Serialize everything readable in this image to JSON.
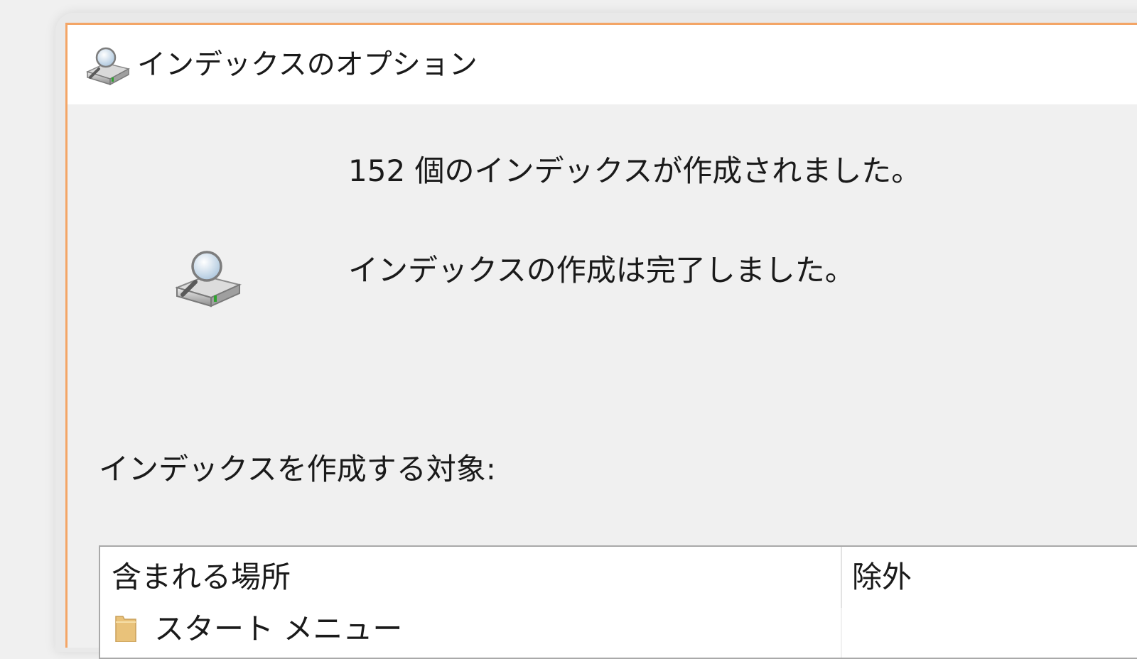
{
  "window": {
    "title": "インデックスのオプション",
    "accent_color": "#f3a566"
  },
  "status": {
    "count_message": "152 個のインデックスが作成されました。",
    "state_message": "インデックスの作成は完了しました。",
    "icon": "indexing-drive-icon"
  },
  "locations": {
    "label": "インデックスを作成する対象:",
    "columns": {
      "included": "含まれる場所",
      "excluded": "除外"
    },
    "rows": [
      {
        "label": "スタート メニュー",
        "icon": "folder-icon"
      }
    ]
  }
}
